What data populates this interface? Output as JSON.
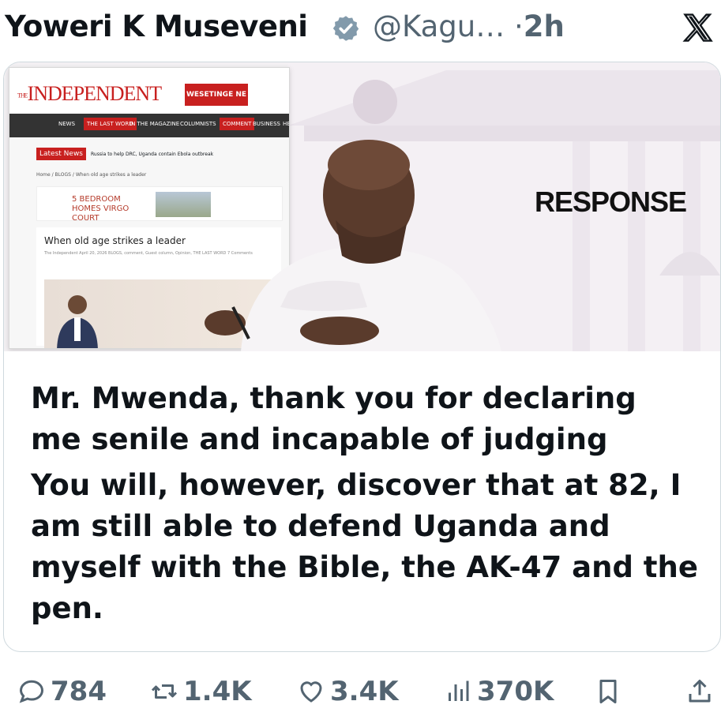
{
  "tweet": {
    "author_name": "Yoweri K Museveni",
    "handle": "@Kagu…",
    "separator": "·",
    "time": "2h",
    "text_lines": [
      "Mr. Mwenda, thank you for declaring",
      "me senile and incapable of judging"
    ],
    "text_lines_2": [
      "You will, however, discover that at 82, I",
      "am still able to defend Uganda and",
      "myself with the Bible, the AK-47 and the",
      "pen."
    ]
  },
  "media": {
    "overlay_word": "RESPONSE",
    "screenshot": {
      "masthead": "INDEPENDENT",
      "masthead_prefix": "THE",
      "ad_label": "WESETINGE NE EQUITY",
      "nav": [
        "NEWS",
        "THE LAST WORD",
        "IN THE MAGAZINE",
        "COLUMNISTS",
        "COMMENT",
        "BUSINESS",
        "HE"
      ],
      "latest_tag": "Latest News",
      "latest_text": "Russia to help DRC, Uganda contain Ebola outbreak",
      "breadcrumb": "Home / BLOGS / When old age strikes a leader",
      "ad_text": "5 BEDROOM HOMES VIRGO COURT",
      "article_title": "When old age strikes a leader",
      "article_meta": "The Independent   April 20, 2026   BLOGS, comment, Guest column, Opinion, THE LAST WORD   7 Comments"
    }
  },
  "actions": {
    "replies": "784",
    "reposts": "1.4K",
    "likes": "3.4K",
    "views": "370K"
  },
  "icons": {
    "verified": "verified-badge-icon",
    "x_logo": "x-logo-icon",
    "reply": "reply-icon",
    "repost": "repost-icon",
    "like": "heart-icon",
    "views": "views-icon",
    "bookmark": "bookmark-icon",
    "share": "share-icon"
  },
  "colors": {
    "text": "#0f1419",
    "secondary": "#536471",
    "border": "#cfd9de",
    "independent_red": "#c8201f"
  }
}
